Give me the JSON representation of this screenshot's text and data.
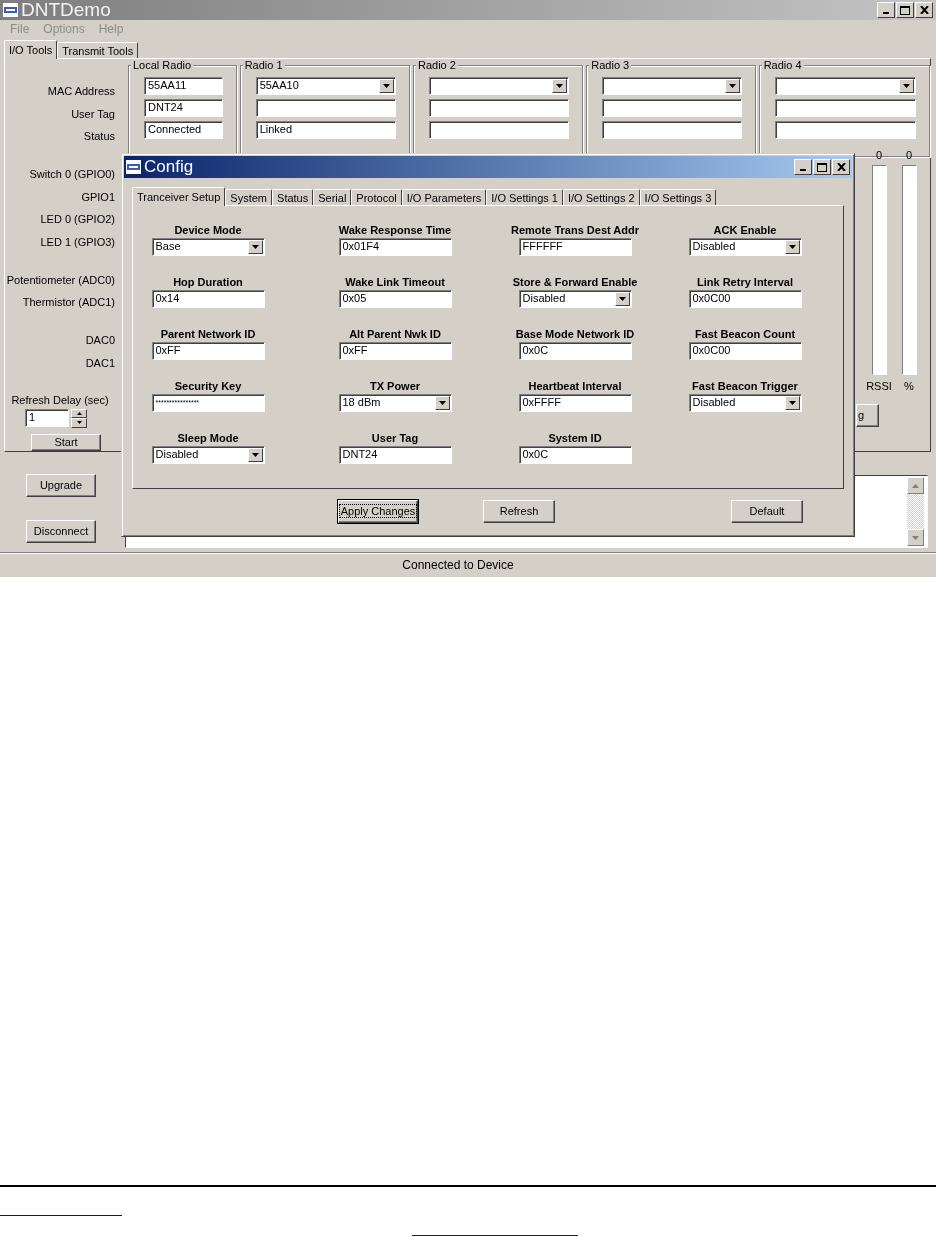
{
  "window": {
    "title": "DNTDemo"
  },
  "menu": [
    "File",
    "Options",
    "Help"
  ],
  "tabs": [
    {
      "label": "I/O Tools",
      "selected": true
    },
    {
      "label": "Transmit Tools",
      "selected": false
    }
  ],
  "io_tools": {
    "label_groups": [
      [
        "MAC Address",
        "User Tag",
        "Status"
      ],
      [
        "Switch 0 (GPIO0)",
        "GPIO1",
        "LED 0 (GPIO2)",
        "LED 1 (GPIO3)"
      ],
      [
        "Potentiometer (ADC0)",
        "Thermistor (ADC1)"
      ],
      [
        "DAC0",
        "DAC1"
      ]
    ],
    "refresh_delay": {
      "label": "Refresh Delay (sec)",
      "value": "1"
    },
    "start_button": "Start",
    "radios": [
      {
        "title": "Local Radio",
        "fields": [
          {
            "kind": "text",
            "value": "55AA11"
          },
          {
            "kind": "text",
            "value": "DNT24"
          },
          {
            "kind": "text",
            "value": "Connected"
          }
        ]
      },
      {
        "title": "Radio 1",
        "fields": [
          {
            "kind": "combo",
            "value": "55AA10"
          },
          {
            "kind": "text"
          },
          {
            "kind": "text",
            "value": "Linked"
          }
        ]
      },
      {
        "title": "Radio 2",
        "fields": [
          {
            "kind": "combo"
          },
          {
            "kind": "text"
          },
          {
            "kind": "text"
          }
        ]
      },
      {
        "title": "Radio 3",
        "fields": [
          {
            "kind": "combo"
          },
          {
            "kind": "text"
          },
          {
            "kind": "text"
          }
        ]
      },
      {
        "title": "Radio 4",
        "fields": [
          {
            "kind": "combo"
          },
          {
            "kind": "text"
          },
          {
            "kind": "text"
          }
        ]
      }
    ],
    "meters": [
      {
        "reading": "0",
        "label": "RSSI",
        "level": 0
      },
      {
        "reading": "0",
        "label": "%",
        "level": 0
      }
    ],
    "partial_button": "g"
  },
  "buttons": [
    "Upgrade",
    "Disconnect"
  ],
  "status_bar": "Connected to Device",
  "config_dialog": {
    "title": "Config",
    "tabs": [
      {
        "label": "Tranceiver Setup",
        "selected": true
      },
      {
        "label": "System",
        "selected": false
      },
      {
        "label": "Status",
        "selected": false
      },
      {
        "label": "Serial",
        "selected": false
      },
      {
        "label": "Protocol",
        "selected": false
      },
      {
        "label": "I/O Parameters",
        "selected": false
      },
      {
        "label": "I/O Settings 1",
        "selected": false
      },
      {
        "label": "I/O Settings 2",
        "selected": false
      },
      {
        "label": "I/O Settings 3",
        "selected": false
      }
    ],
    "fields": [
      {
        "label": "Device Mode",
        "kind": "combo",
        "value": "Base"
      },
      {
        "label": "Wake Response Time",
        "kind": "text",
        "value": "0x01F4"
      },
      {
        "label": "Remote Trans Dest Addr",
        "kind": "text",
        "value": "FFFFFF"
      },
      {
        "label": "ACK Enable",
        "kind": "combo",
        "value": "Disabled"
      },
      {
        "label": "Hop Duration",
        "kind": "text",
        "value": "0x14"
      },
      {
        "label": "Wake Link Timeout",
        "kind": "text",
        "value": "0x05"
      },
      {
        "label": "Store & Forward Enable",
        "kind": "combo",
        "value": "Disabled"
      },
      {
        "label": "Link Retry Interval",
        "kind": "text",
        "value": "0x0C00"
      },
      {
        "label": "Parent Network ID",
        "kind": "text",
        "value": "0xFF"
      },
      {
        "label": "Alt Parent Nwk ID",
        "kind": "text",
        "value": "0xFF"
      },
      {
        "label": "Base Mode Network ID",
        "kind": "text",
        "value": "0x0C"
      },
      {
        "label": "Fast Beacon Count",
        "kind": "text",
        "value": "0x0C00"
      },
      {
        "label": "Security Key",
        "kind": "password",
        "value": "****************"
      },
      {
        "label": "TX Power",
        "kind": "combo",
        "value": "18 dBm"
      },
      {
        "label": "Heartbeat Interval",
        "kind": "text",
        "value": "0xFFFF"
      },
      {
        "label": "Fast Beacon Trigger",
        "kind": "combo",
        "value": "Disabled"
      },
      {
        "label": "Sleep Mode",
        "kind": "combo",
        "value": "Disabled"
      },
      {
        "label": "User Tag",
        "kind": "text",
        "value": "DNT24"
      },
      {
        "label": "System ID",
        "kind": "text",
        "value": "0x0C"
      }
    ],
    "buttons": [
      {
        "label": "Apply Changes",
        "focused": true
      },
      {
        "label": "Refresh",
        "focused": false
      },
      {
        "label": "Default",
        "focused": false
      }
    ]
  }
}
